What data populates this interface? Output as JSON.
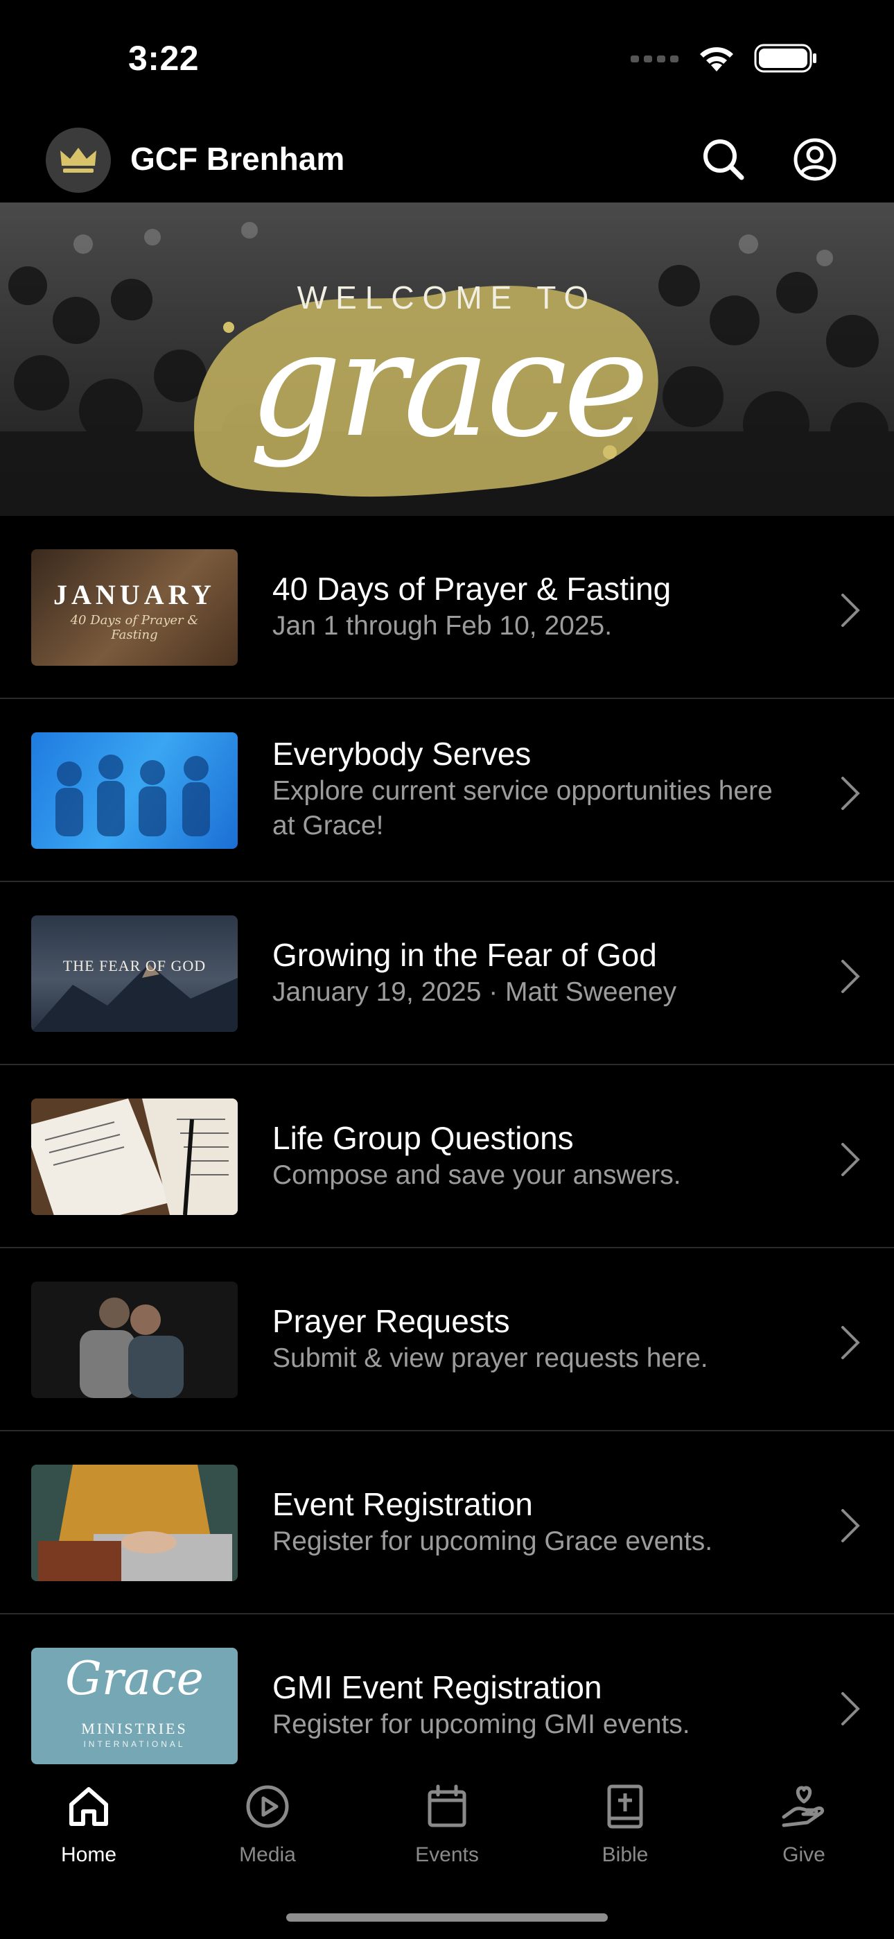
{
  "status_bar": {
    "time": "3:22"
  },
  "header": {
    "title": "GCF Brenham"
  },
  "hero": {
    "line1": "WELCOME TO",
    "line2": "grace"
  },
  "items": [
    {
      "title": "40 Days of Prayer & Fasting",
      "subtitle": "Jan 1 through Feb 10, 2025.",
      "thumb_text": "JANUARY",
      "thumb_sub": "40 Days of Prayer & Fasting"
    },
    {
      "title": "Everybody Serves",
      "subtitle": "Explore current service opportunities here at Grace!"
    },
    {
      "title": "Growing in the Fear of God",
      "subtitle": "January 19, 2025 · Matt Sweeney",
      "thumb_text": "THE FEAR OF GOD"
    },
    {
      "title": "Life Group Questions",
      "subtitle": "Compose and save your answers."
    },
    {
      "title": "Prayer Requests",
      "subtitle": "Submit & view prayer requests here."
    },
    {
      "title": "Event Registration",
      "subtitle": "Register for upcoming Grace events."
    },
    {
      "title": "GMI Event Registration",
      "subtitle": "Register for upcoming GMI events.",
      "thumb_text": "Grace",
      "thumb_sub": "MINISTRIES",
      "thumb_sub2": "INTERNATIONAL"
    }
  ],
  "tabs": [
    {
      "label": "Home",
      "icon": "home-icon",
      "active": true
    },
    {
      "label": "Media",
      "icon": "play-icon"
    },
    {
      "label": "Events",
      "icon": "calendar-icon"
    },
    {
      "label": "Bible",
      "icon": "bible-icon"
    },
    {
      "label": "Give",
      "icon": "give-icon"
    }
  ],
  "colors": {
    "accent_gold": "#c9b86a",
    "background": "#000000",
    "subtitle": "#9c9c9c"
  }
}
